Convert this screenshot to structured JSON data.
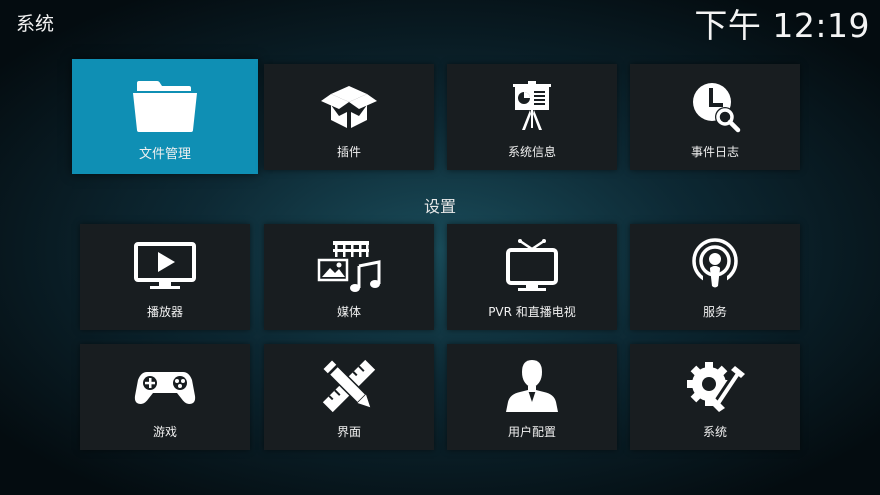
{
  "header": {
    "title": "系统",
    "clock": "下午 12:19"
  },
  "section": {
    "settings_label": "设置"
  },
  "top_tiles": [
    {
      "label": "文件管理",
      "icon": "folder-icon"
    },
    {
      "label": "插件",
      "icon": "open-box-icon"
    },
    {
      "label": "系统信息",
      "icon": "presentation-board-icon"
    },
    {
      "label": "事件日志",
      "icon": "clock-search-icon"
    }
  ],
  "settings_tiles": [
    {
      "label": "播放器",
      "icon": "monitor-play-icon"
    },
    {
      "label": "媒体",
      "icon": "media-library-icon"
    },
    {
      "label": "PVR 和直播电视",
      "icon": "tv-antenna-icon"
    },
    {
      "label": "服务",
      "icon": "broadcast-icon"
    },
    {
      "label": "游戏",
      "icon": "gamepad-icon"
    },
    {
      "label": "界面",
      "icon": "pencil-ruler-icon"
    },
    {
      "label": "用户配置",
      "icon": "user-profile-icon"
    },
    {
      "label": "系统",
      "icon": "gear-wrench-icon"
    }
  ],
  "colors": {
    "focus": "#0f8fb4",
    "tile": "#181d20"
  }
}
